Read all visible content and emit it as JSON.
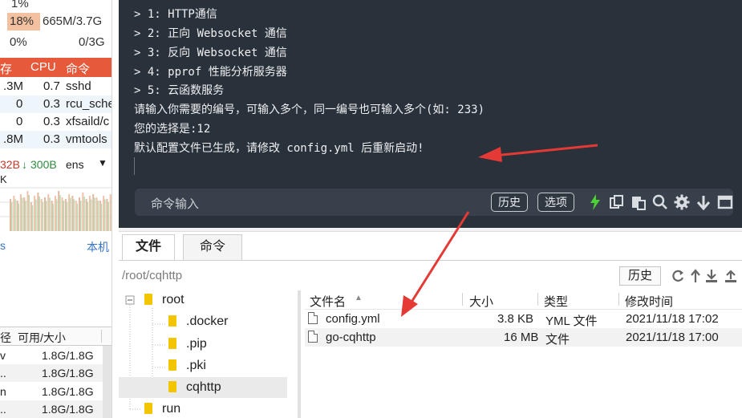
{
  "sysmon": {
    "mem_row_partial": "1%",
    "mem_pct": "18%",
    "mem_used": "665M/3.7G",
    "swap_pct": "0%",
    "swap_used": "0/3G",
    "mem_fill": 0.18,
    "head_mem": "存",
    "head_cpu": "CPU",
    "head_cmd": "命令",
    "processes": [
      {
        "mem": ".3M",
        "cpu": "0.7",
        "cmd": "sshd"
      },
      {
        "mem": "0",
        "cpu": "0.3",
        "cmd": "rcu_sche"
      },
      {
        "mem": "0",
        "cpu": "0.3",
        "cmd": "xfsaild/c"
      },
      {
        "mem": ".8M",
        "cpu": "0.3",
        "cmd": "vmtools"
      }
    ],
    "net_up": "32B",
    "net_down_arrow": "↓",
    "net_down": "300B",
    "net_iface": "ens",
    "net_dropdown": "▼",
    "graph_label": "K",
    "link_s": "s",
    "link_local": "本机",
    "disk_head_path": "径",
    "disk_head_size": "可用/大小",
    "disks": [
      {
        "path": "v",
        "size": "1.8G/1.8G"
      },
      {
        "path": "..",
        "size": "1.8G/1.8G"
      },
      {
        "path": "n",
        "size": "1.8G/1.8G"
      },
      {
        "path": "..",
        "size": "1.8G/1.8G"
      }
    ]
  },
  "terminal": {
    "lines": [
      "> 1: HTTP通信",
      "> 2: 正向 Websocket 通信",
      "> 3: 反向 Websocket 通信",
      "> 4: pprof 性能分析服务器",
      "> 5: 云函数服务",
      "请输入你需要的编号，可输入多个，同一编号也可输入多个(如: 233)",
      "您的选择是:12",
      "默认配置文件已生成，请修改 config.yml 后重新启动!"
    ],
    "command_placeholder": "命令输入",
    "history_button": "历史",
    "options_button": "选项"
  },
  "file_manager": {
    "tabs": [
      "文件",
      "命令"
    ],
    "path": "/root/cqhttp",
    "history_button": "历史",
    "tree": [
      {
        "label": "root",
        "level": 0
      },
      {
        "label": ".docker",
        "level": 1
      },
      {
        "label": ".pip",
        "level": 1
      },
      {
        "label": ".pki",
        "level": 1
      },
      {
        "label": "cqhttp",
        "level": 1,
        "selected": true
      },
      {
        "label": "run",
        "level": 0
      }
    ],
    "columns": {
      "name": "文件名",
      "sort_arrow": "▲",
      "size": "大小",
      "type": "类型",
      "modified": "修改时间"
    },
    "files": [
      {
        "name": "config.yml",
        "size": "3.8 KB",
        "type": "YML 文件",
        "modified": "2021/11/18 17:02"
      },
      {
        "name": "go-cqhttp",
        "size": "16 MB",
        "type": "文件",
        "modified": "2021/11/18 17:00"
      }
    ]
  },
  "colors": {
    "terminal_bg": "#29313a",
    "process_header": "#e6593b",
    "annotation_arrow": "#e53935",
    "folder": "#f3c400"
  }
}
